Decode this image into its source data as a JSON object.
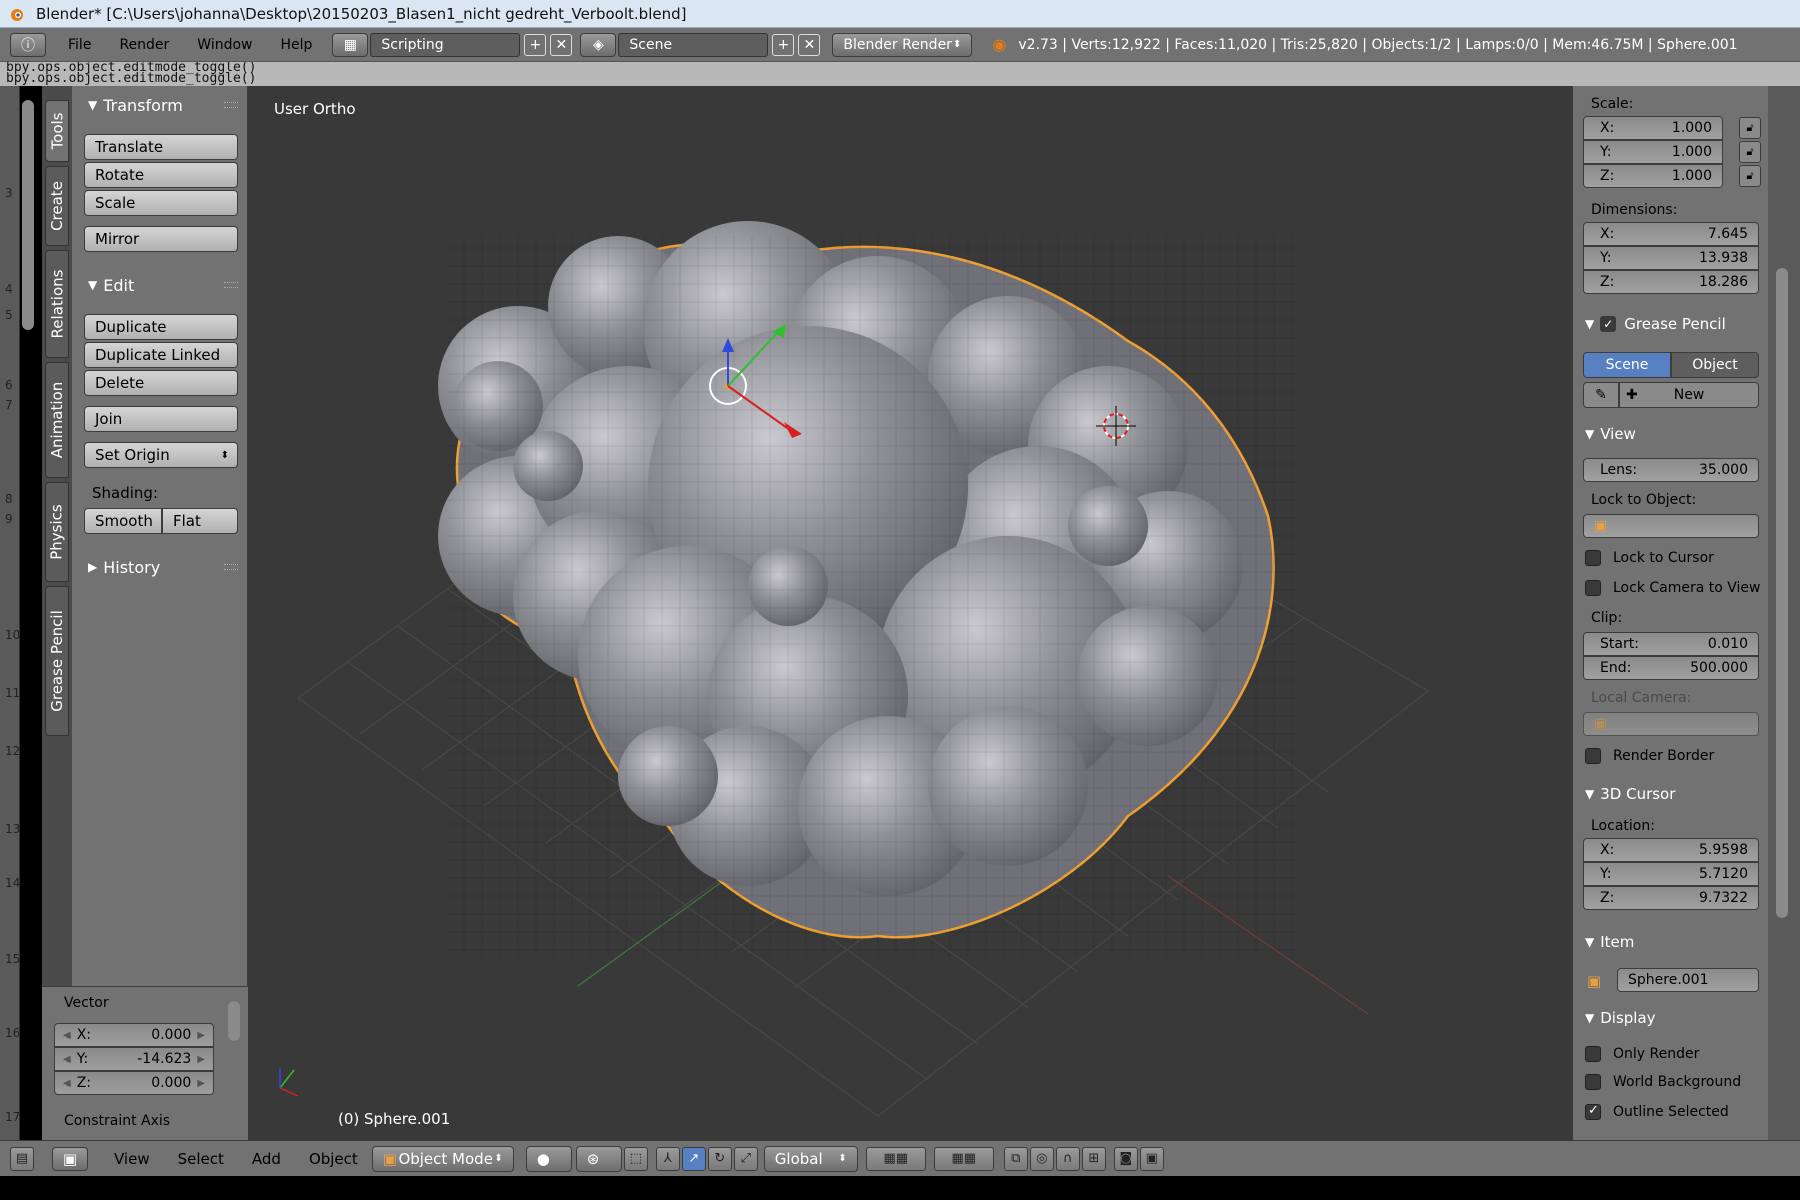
{
  "window": {
    "title": "Blender* [C:\\Users\\johanna\\Desktop\\20150203_Blasen1_nicht gedreht_Verboolt.blend]"
  },
  "info_header": {
    "menus": [
      "File",
      "Render",
      "Window",
      "Help"
    ],
    "layout": "Scripting",
    "scene": "Scene",
    "engine": "Blender Render",
    "stats": "v2.73 | Verts:12,922 | Faces:11,020 | Tris:25,820 | Objects:1/2 | Lamps:0/0 | Mem:46.75M | Sphere.001"
  },
  "console": {
    "lines": [
      "bpy.ops.object.editmode_toggle()",
      "bpy.ops.object.editmode_toggle()"
    ]
  },
  "left_gutter_numbers": [
    "3",
    "4",
    "5",
    "6",
    "7",
    "8",
    "9",
    "10",
    "11",
    "12",
    "13",
    "14",
    "15",
    "16",
    "17"
  ],
  "tabs": [
    "Tools",
    "Create",
    "Relations",
    "Animation",
    "Physics",
    "Grease Pencil"
  ],
  "tools": {
    "transform_header": "Transform",
    "translate": "Translate",
    "rotate": "Rotate",
    "scale": "Scale",
    "mirror": "Mirror",
    "edit_header": "Edit",
    "duplicate": "Duplicate",
    "duplicate_linked": "Duplicate Linked",
    "delete": "Delete",
    "join": "Join",
    "set_origin": "Set Origin",
    "shading_label": "Shading:",
    "smooth": "Smooth",
    "flat": "Flat",
    "history_header": "History"
  },
  "operator": {
    "title": "Vector",
    "x_label": "X:",
    "x_value": "0.000",
    "y_label": "Y:",
    "y_value": "-14.623",
    "z_label": "Z:",
    "z_value": "0.000",
    "constraint": "Constraint Axis"
  },
  "viewport": {
    "view_name": "User Ortho",
    "object_label": "(0) Sphere.001"
  },
  "properties": {
    "scale_label": "Scale:",
    "scale": [
      {
        "label": "X:",
        "value": "1.000"
      },
      {
        "label": "Y:",
        "value": "1.000"
      },
      {
        "label": "Z:",
        "value": "1.000"
      }
    ],
    "dimensions_label": "Dimensions:",
    "dimensions": [
      {
        "label": "X:",
        "value": "7.645"
      },
      {
        "label": "Y:",
        "value": "13.938"
      },
      {
        "label": "Z:",
        "value": "18.286"
      }
    ],
    "grease_pencil_header": "Grease Pencil",
    "gp_scene": "Scene",
    "gp_object": "Object",
    "gp_new": "New",
    "view_header": "View",
    "lens_label": "Lens:",
    "lens_value": "35.000",
    "lock_to_object": "Lock to Object:",
    "lock_to_cursor": "Lock to Cursor",
    "lock_camera": "Lock Camera to View",
    "clip_label": "Clip:",
    "clip_start_label": "Start:",
    "clip_start": "0.010",
    "clip_end_label": "End:",
    "clip_end": "500.000",
    "local_camera": "Local Camera:",
    "render_border": "Render Border",
    "cursor_header": "3D Cursor",
    "location_label": "Location:",
    "cursor": [
      {
        "label": "X:",
        "value": "5.9598"
      },
      {
        "label": "Y:",
        "value": "5.7120"
      },
      {
        "label": "Z:",
        "value": "9.7322"
      }
    ],
    "item_header": "Item",
    "item_name": "Sphere.001",
    "display_header": "Display",
    "only_render": "Only Render",
    "world_background": "World Background",
    "outline_selected": "Outline Selected"
  },
  "bottom_header": {
    "menus": [
      "View",
      "Select",
      "Add",
      "Object"
    ],
    "mode": "Object Mode",
    "orientation": "Global"
  },
  "colors": {
    "selection_outline": "#f0a030",
    "active_button": "#5680c2",
    "viewport_bg": "#393939"
  }
}
